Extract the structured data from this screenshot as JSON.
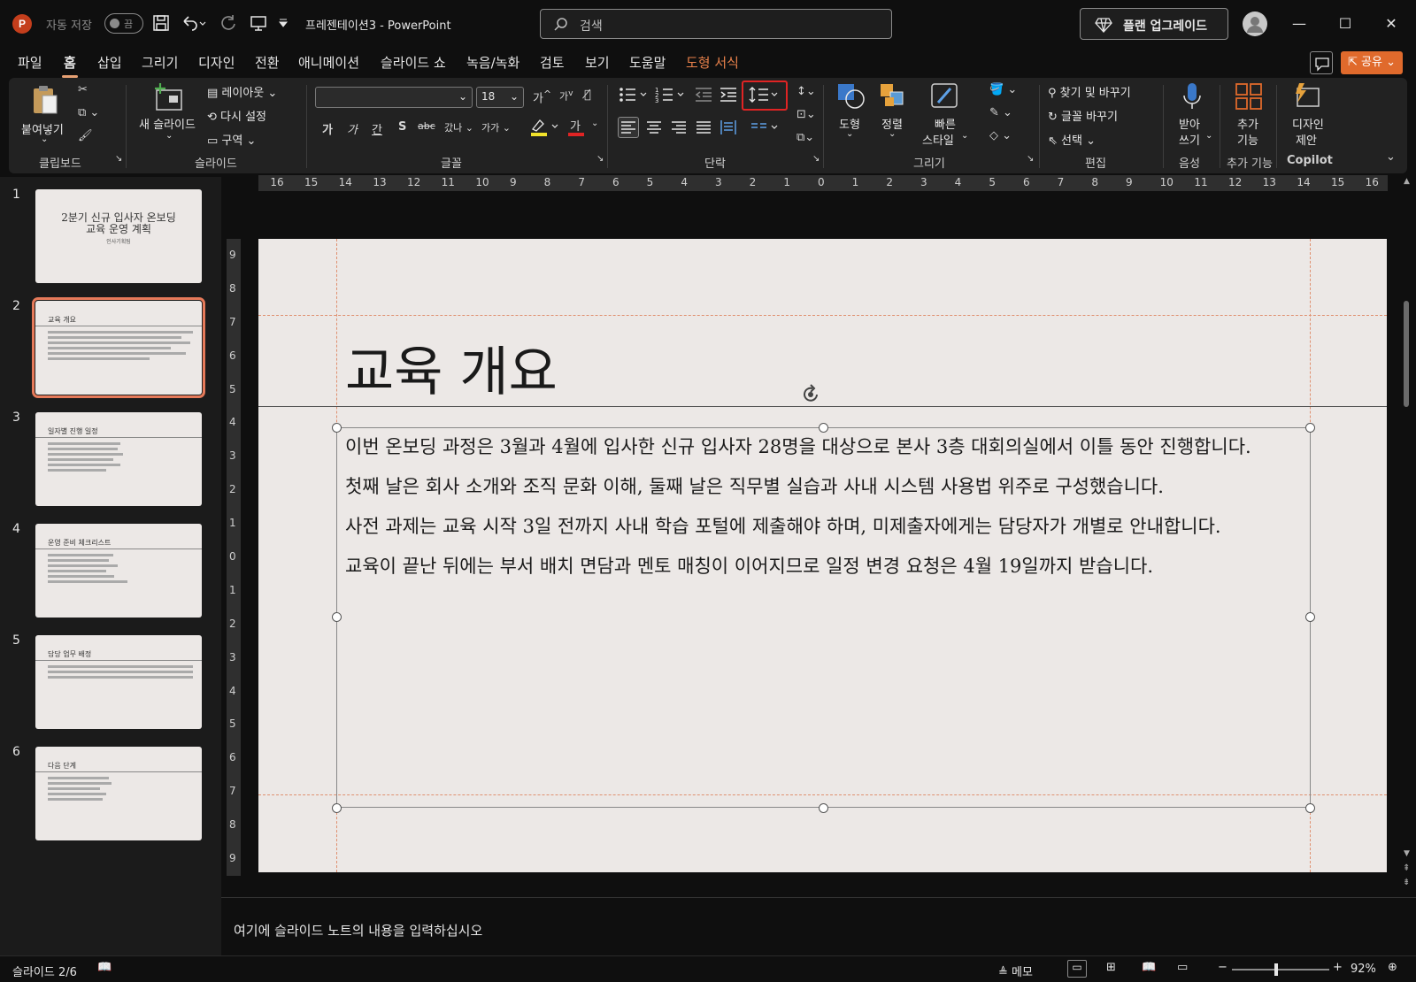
{
  "titlebar": {
    "app_logo": "P",
    "autosave_label": "자동 저장",
    "autosave_state": "끔",
    "doc_title": "프레젠테이션3  -  PowerPoint",
    "search_placeholder": "검색",
    "upgrade_label": "플랜 업그레이드"
  },
  "menu": {
    "items": [
      "파일",
      "홈",
      "삽입",
      "그리기",
      "디자인",
      "전환",
      "애니메이션",
      "슬라이드 쇼",
      "녹음/녹화",
      "검토",
      "보기",
      "도움말",
      "도형 서식"
    ],
    "active": "홈",
    "share_label": "공유"
  },
  "ribbon": {
    "clipboard": {
      "group": "클립보드",
      "paste": "붙여넣기"
    },
    "slides": {
      "group": "슬라이드",
      "new_slide": "새 슬라이드",
      "layout": "레이아웃",
      "reset": "다시 설정",
      "section": "구역"
    },
    "font": {
      "group": "글꼴",
      "font_name": "",
      "font_size": "18",
      "bold": "가",
      "italic": "가",
      "underline": "간",
      "shadow": "S",
      "strike": "abc",
      "spacing": "갔나",
      "case": "가가",
      "font_color_letter": "가"
    },
    "paragraph": {
      "group": "단락"
    },
    "drawing": {
      "group": "그리기",
      "shape": "도형",
      "arrange": "정렬",
      "quick_style_1": "빠른",
      "quick_style_2": "스타일"
    },
    "editing": {
      "group": "편집",
      "find": "찾기 및 바꾸기",
      "replace_font": "글꼴 바꾸기",
      "select": "선택"
    },
    "voice": {
      "group": "음성",
      "dictate_1": "받아",
      "dictate_2": "쓰기"
    },
    "addins": {
      "group": "추가 기능",
      "addins_1": "추가",
      "addins_2": "기능"
    },
    "copilot": {
      "group": "Copilot",
      "designer_1": "디자인",
      "designer_2": "제안"
    }
  },
  "ruler": {
    "h_ticks": [
      "16",
      "15",
      "14",
      "13",
      "12",
      "11",
      "10",
      "9",
      "8",
      "7",
      "6",
      "5",
      "4",
      "3",
      "2",
      "1",
      "0",
      "1",
      "2",
      "3",
      "4",
      "5",
      "6",
      "7",
      "8",
      "9",
      "10",
      "11",
      "12",
      "13",
      "14",
      "15",
      "16"
    ],
    "v_ticks": [
      "9",
      "8",
      "7",
      "6",
      "5",
      "4",
      "3",
      "2",
      "1",
      "0",
      "1",
      "2",
      "3",
      "4",
      "5",
      "6",
      "7",
      "8",
      "9"
    ]
  },
  "thumbnails": [
    {
      "num": "1",
      "title": "2분기 신규 입사자 온보딩\n교육 운영 계획",
      "subtitle": "인사기획팀",
      "cover": true
    },
    {
      "num": "2",
      "title": "교육 개요",
      "active": true
    },
    {
      "num": "3",
      "title": "일자별 진행 일정"
    },
    {
      "num": "4",
      "title": "운영 준비 체크리스트"
    },
    {
      "num": "5",
      "title": "담당 업무 배정"
    },
    {
      "num": "6",
      "title": "다음 단계"
    }
  ],
  "slide": {
    "title": "교육 개요",
    "paragraphs": [
      "이번 온보딩 과정은 3월과 4월에 입사한 신규 입사자 28명을 대상으로 본사 3층 대회의실에서 이틀 동안 진행합니다.",
      "첫째 날은 회사 소개와 조직 문화 이해, 둘째 날은 직무별 실습과 사내 시스템 사용법 위주로 구성했습니다.",
      "사전 과제는 교육 시작 3일 전까지 사내 학습 포털에 제출해야 하며, 미제출자에게는 담당자가 개별로 안내합니다.",
      "교육이 끝난 뒤에는 부서 배치 면담과 멘토 매칭이 이어지므로 일정 변경 요청은 4월 19일까지 받습니다."
    ]
  },
  "notes": {
    "placeholder": "여기에 슬라이드 노트의 내용을 입력하십시오"
  },
  "status": {
    "slide_counter": "슬라이드 2/6",
    "notes_label": "메모",
    "zoom": "92%"
  },
  "colors": {
    "accent": "#e06a2c",
    "highlight_box": "#e02424",
    "thumb_active": "#e67a5a"
  }
}
